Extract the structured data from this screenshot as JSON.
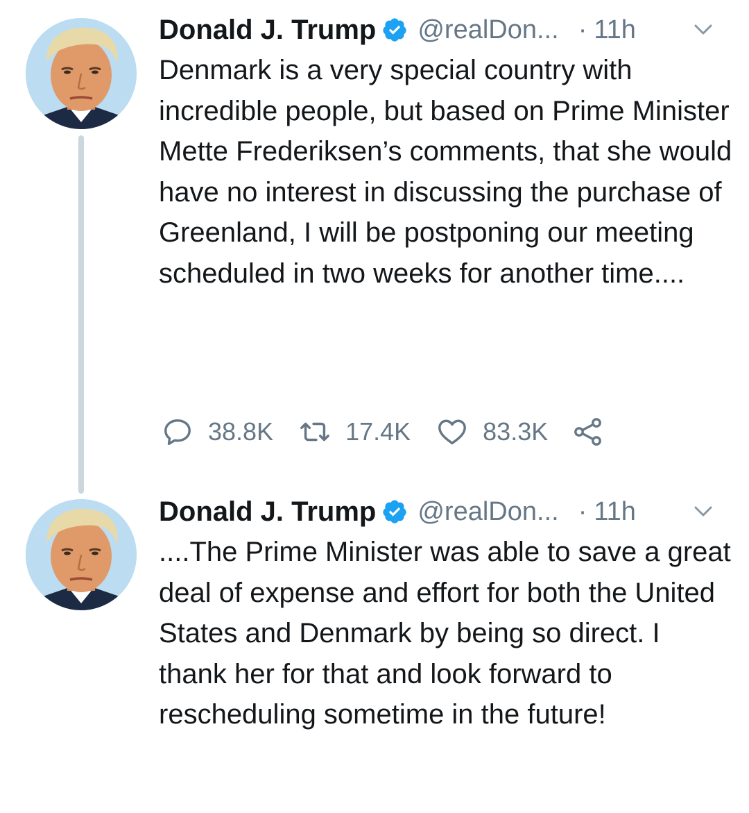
{
  "thread": {
    "tweets": [
      {
        "author": {
          "name": "Donald J. Trump",
          "handle": "@realDon...",
          "verified": true
        },
        "time_separator": "·",
        "time": "11h",
        "text": "Denmark is a very special country with incredible people, but based on Prime Minister Mette Frederiksen’s comments, that she would have no interest in discussing the purchase of Greenland, I will be postponing our meeting scheduled in two weeks for another time....",
        "actions": {
          "replies": "38.8K",
          "retweets": "17.4K",
          "likes": "83.3K"
        }
      },
      {
        "author": {
          "name": "Donald J. Trump",
          "handle": "@realDon...",
          "verified": true
        },
        "time_separator": "·",
        "time": "11h",
        "text": "....The Prime Minister was able to save a great deal of expense and effort for both the United States and Denmark by being so direct. I thank her for that and look forward to rescheduling sometime in the future!"
      }
    ]
  },
  "colors": {
    "text_primary": "#14171a",
    "text_secondary": "#657786",
    "verified_blue": "#1da1f2",
    "thread_line": "#ccd6dd",
    "avatar_background": "#bcdcf2"
  },
  "icons": {
    "reply": "reply-icon",
    "retweet": "retweet-icon",
    "like": "heart-icon",
    "share": "share-icon",
    "verified": "verified-badge-icon",
    "caret": "chevron-down-icon"
  }
}
